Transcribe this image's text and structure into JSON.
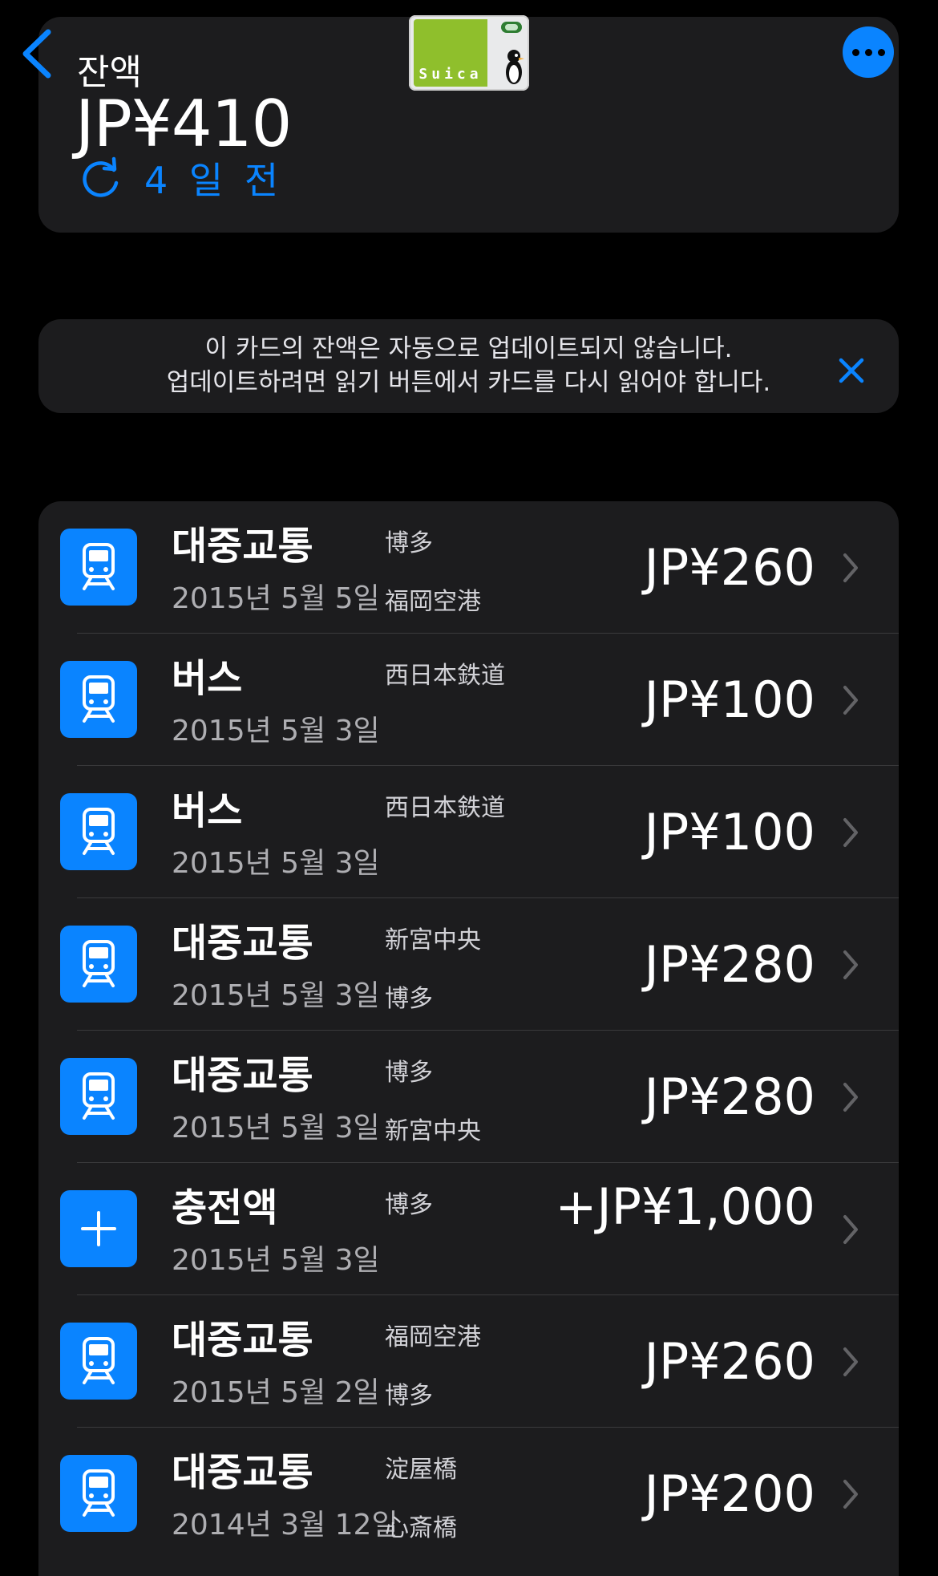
{
  "header": {
    "balance_label": "잔액",
    "balance_amount": "JP¥410",
    "last_updated": "4 일 전",
    "card_name": "Suica"
  },
  "notice": {
    "line1": "이 카드의 잔액은 자동으로 업데이트되지 않습니다.",
    "line2": "업데이트하려면 읽기 버튼에서 카드를 다시 읽어야 합니다."
  },
  "colors": {
    "accent": "#0a84ff",
    "background": "#000000",
    "card": "#1c1c1e"
  },
  "transactions": [
    {
      "icon": "train-icon",
      "title": "대중교통",
      "date": "2015년 5월 5일",
      "from": "博多",
      "to": "福岡空港",
      "amount": "JP¥260"
    },
    {
      "icon": "train-icon",
      "title": "버스",
      "date": "2015년 5월 3일",
      "from": "西日本鉄道",
      "to": "",
      "amount": "JP¥100"
    },
    {
      "icon": "train-icon",
      "title": "버스",
      "date": "2015년 5월 3일",
      "from": "西日本鉄道",
      "to": "",
      "amount": "JP¥100"
    },
    {
      "icon": "train-icon",
      "title": "대중교통",
      "date": "2015년 5월 3일",
      "from": "新宮中央",
      "to": "博多",
      "amount": "JP¥280"
    },
    {
      "icon": "train-icon",
      "title": "대중교통",
      "date": "2015년 5월 3일",
      "from": "博多",
      "to": "新宮中央",
      "amount": "JP¥280"
    },
    {
      "icon": "plus-icon",
      "title": "충전액",
      "date": "2015년 5월 3일",
      "from": "博多",
      "to": "",
      "amount": "+JP¥1,000"
    },
    {
      "icon": "train-icon",
      "title": "대중교통",
      "date": "2015년 5월 2일",
      "from": "福岡空港",
      "to": "博多",
      "amount": "JP¥260"
    },
    {
      "icon": "train-icon",
      "title": "대중교통",
      "date": "2014년 3월 12일",
      "from": "淀屋橋",
      "to": "心斎橋",
      "amount": "JP¥200"
    }
  ]
}
